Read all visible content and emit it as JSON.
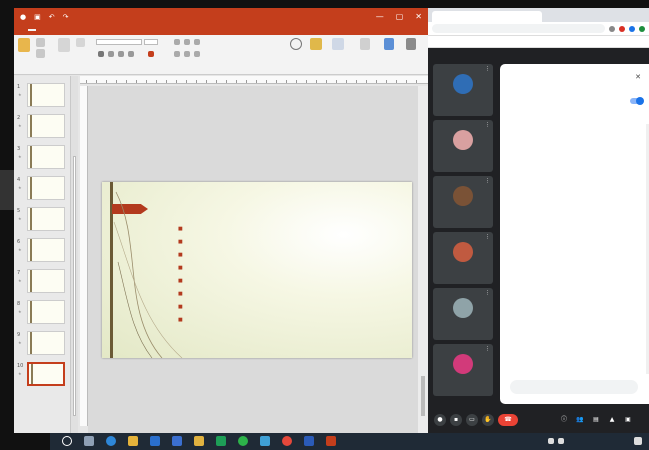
{
  "powerpoint": {
    "title": "",
    "ribbon_tabs": [
      "",
      "",
      "",
      "",
      "",
      "",
      "",
      "",
      "",
      ""
    ],
    "thumbnails": [
      {
        "num": "1"
      },
      {
        "num": "2"
      },
      {
        "num": "3"
      },
      {
        "num": "4"
      },
      {
        "num": "5"
      },
      {
        "num": "6"
      },
      {
        "num": "7"
      },
      {
        "num": "8"
      },
      {
        "num": "9"
      },
      {
        "num": "10"
      }
    ],
    "slide": {
      "title": "",
      "bullets": [
        "",
        "",
        "",
        "",
        "",
        "",
        "",
        ""
      ]
    }
  },
  "browser": {
    "tab_title": "",
    "url": "",
    "bookmarks": [
      "",
      ""
    ]
  },
  "meeting": {
    "participants": [
      {
        "name": "",
        "avatar_color": "#2f6db5"
      },
      {
        "name": "",
        "avatar_color": "#d9a0a0"
      },
      {
        "name": "",
        "avatar_color": "#7a5236"
      },
      {
        "name": "",
        "avatar_color": "#c05a40"
      },
      {
        "name": "",
        "avatar_color": "#8fa3a8"
      },
      {
        "name": "",
        "avatar_color": "#d23a7a"
      }
    ],
    "chat_panel": {
      "title": "",
      "toggle_label": "",
      "messages": [
        {
          "who": "",
          "time": "",
          "text": ""
        },
        {
          "who": "",
          "time": "",
          "text": ""
        },
        {
          "who": "",
          "time": "",
          "text": ""
        },
        {
          "who": "",
          "time": "",
          "text": ""
        },
        {
          "who": "",
          "time": "",
          "text": ""
        },
        {
          "who": "",
          "time": "",
          "text": ""
        },
        {
          "who": "",
          "time": "",
          "text": ""
        },
        {
          "who": "",
          "time": "",
          "text": ""
        }
      ],
      "input_placeholder": ""
    }
  },
  "taskbar": {
    "weather": "",
    "time": "",
    "date": ""
  },
  "colors": {
    "ppt_accent": "#c43e1c",
    "slide_bullet": "#b33a1e",
    "meet_bg": "#202124",
    "end_call": "#ea4335",
    "toggle_on": "#1a73e8"
  }
}
